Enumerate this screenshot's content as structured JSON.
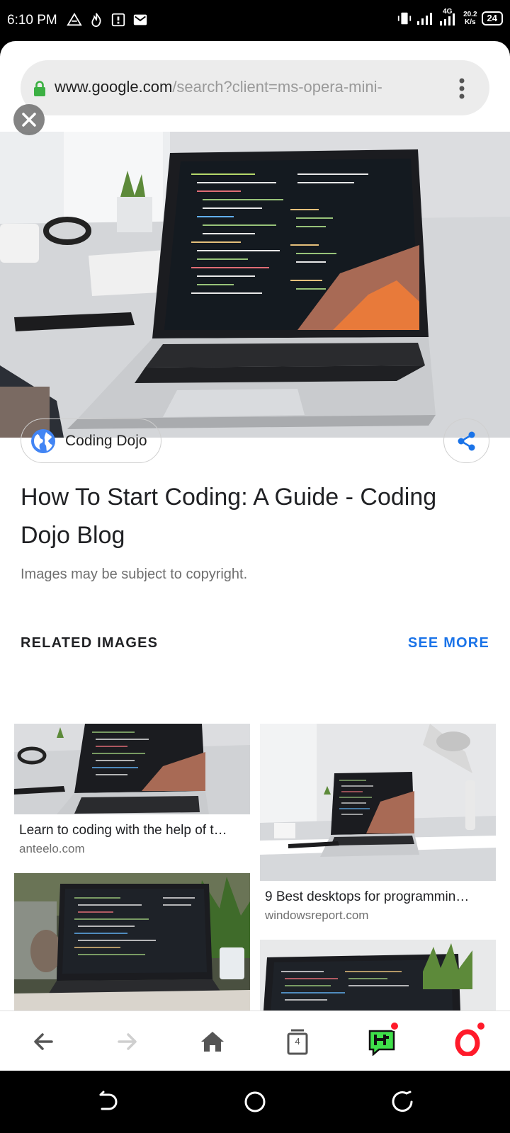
{
  "status_bar": {
    "time": "6:10 PM",
    "network_type": "4G",
    "speed_value": "20.2",
    "speed_unit": "K/s",
    "battery": "24",
    "icons": [
      "drive-icon",
      "fire-icon",
      "save-icon",
      "mail-icon"
    ]
  },
  "browser": {
    "url_domain": "www.google.com",
    "url_path": "/search?client=ms-opera-mini-",
    "secure": true
  },
  "image_viewer": {
    "source_name": "Coding Dojo",
    "title": "How To Start Coding: A Guide - Coding Dojo Blog",
    "copyright_note": "Images may be subject to copyright."
  },
  "related": {
    "heading": "RELATED IMAGES",
    "see_more": "SEE MORE",
    "items": [
      {
        "title": "Learn to coding with the help of t…",
        "site": "anteelo.com"
      },
      {
        "title": "9 Best desktops for programmin…",
        "site": "windowsreport.com"
      }
    ]
  },
  "toolbar": {
    "tab_count": "4",
    "items": [
      "back-icon",
      "forward-icon",
      "home-icon",
      "tabs-icon",
      "hype-icon",
      "opera-icon"
    ]
  },
  "colors": {
    "accent": "#1a73e8",
    "secure_lock": "#3cb043",
    "opera_red": "#ff1a2a",
    "hype_green": "#3fe04a"
  }
}
